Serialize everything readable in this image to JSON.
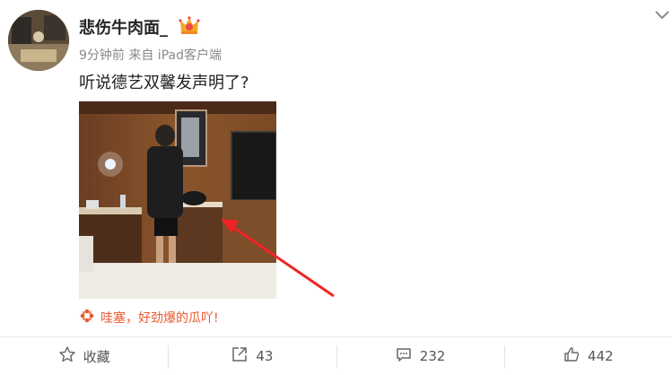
{
  "post": {
    "username": "悲伤牛肉面_",
    "meta": "9分钟前 来自 iPad客户端",
    "text": "听说德艺双馨发声明了?",
    "comment_hint": "哇塞，好劲爆的瓜吖!"
  },
  "actions": {
    "favorite": "收藏",
    "repost": "43",
    "comment": "232",
    "like": "442"
  },
  "icons": [
    "crown-badge-icon",
    "chevron-down-icon",
    "pinwheel-icon",
    "star-icon",
    "share-icon",
    "comment-icon",
    "thumbs-up-icon"
  ],
  "colors": {
    "accent": "#e8592e",
    "muted": "#8a8a8a"
  }
}
